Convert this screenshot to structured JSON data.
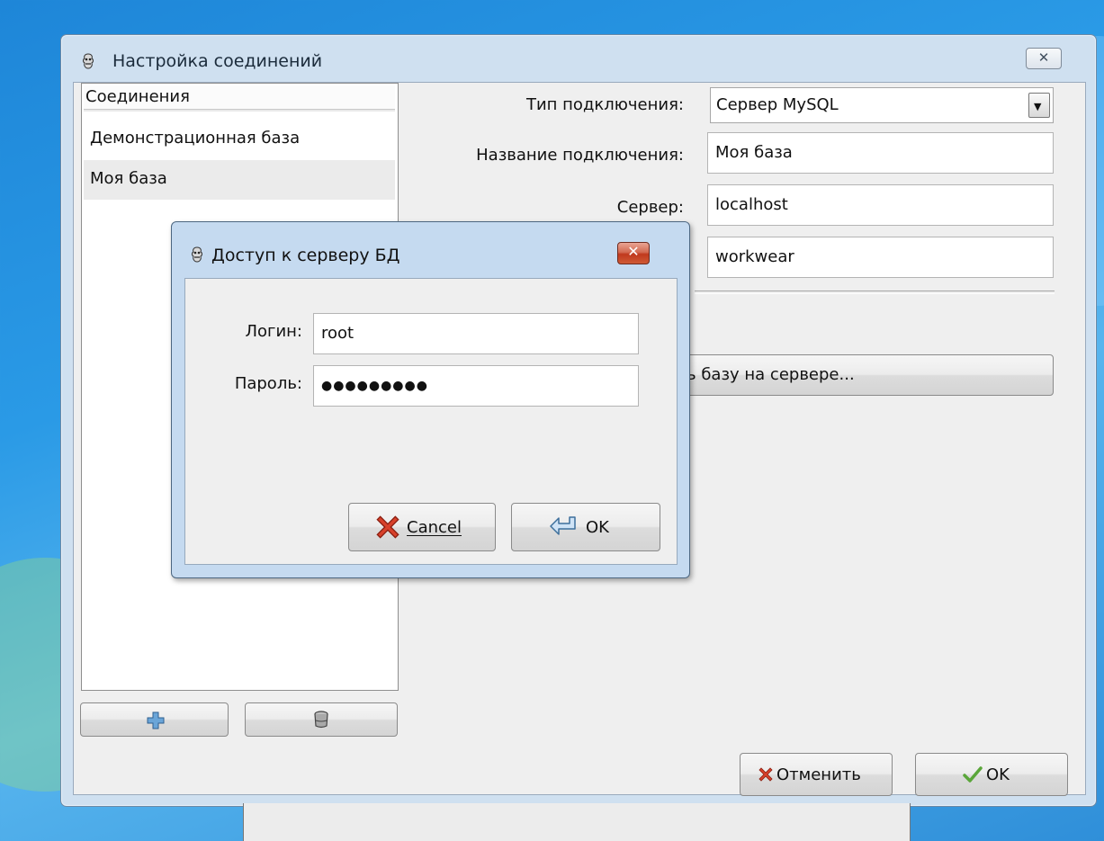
{
  "main_window": {
    "title": "Настройка соединений",
    "close_symbol": "✕",
    "connections": {
      "header": "Соединения",
      "items": [
        {
          "label": "Демонстрационная база",
          "selected": false
        },
        {
          "label": "Моя база",
          "selected": true
        }
      ],
      "add_icon": "plus-icon",
      "delete_icon": "trash-can-icon"
    },
    "form": {
      "type_label": "Тип подключения:",
      "type_value": "Сервер MySQL",
      "name_label": "Название подключения:",
      "name_value": "Моя база",
      "server_label": "Сервер:",
      "server_value": "localhost",
      "database_value": "workwear",
      "create_db_button": "ь базу на сервере..."
    },
    "footer": {
      "cancel_label": "Отменить",
      "ok_label": "OK"
    }
  },
  "dialog": {
    "title": "Доступ к серверу БД",
    "close_symbol": "✕",
    "login_label": "Логин:",
    "login_value": "root",
    "password_label": "Пароль:",
    "password_value": "●●●●●●●●●",
    "cancel_label": "Cancel",
    "cancel_mnemonic": "C",
    "ok_label": "OK",
    "ok_mnemonic": "O"
  },
  "colors": {
    "desktop": "#2a9ae6",
    "window_frame": "#cfe0f0",
    "dialog_frame": "#c5daf0",
    "dialog_close": "#c0391d",
    "client_bg": "#efefef"
  }
}
